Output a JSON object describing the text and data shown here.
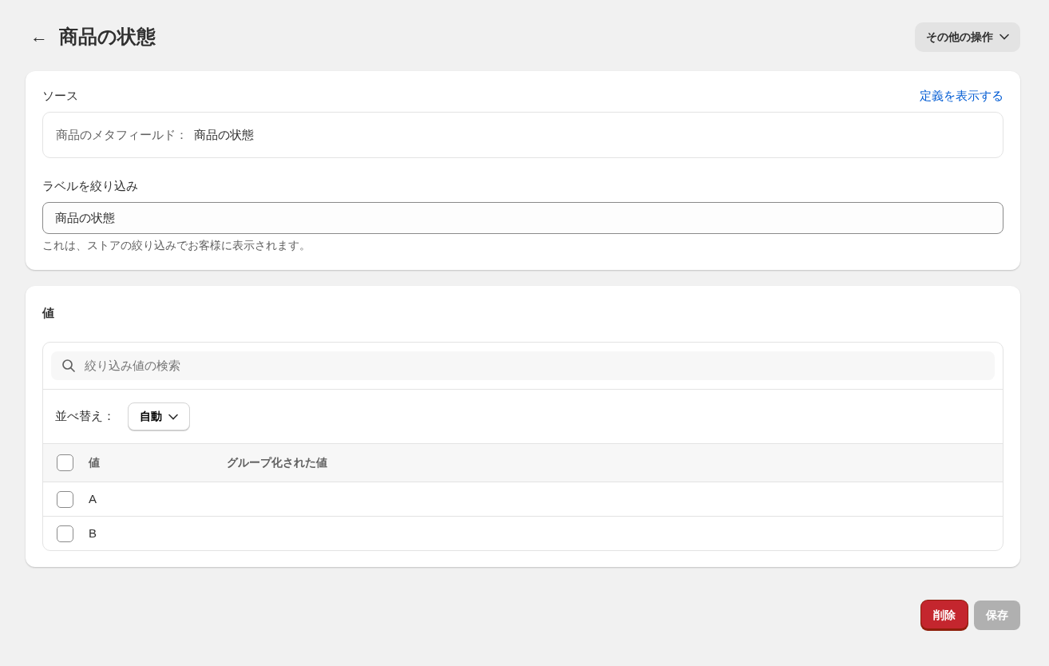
{
  "header": {
    "back": "←",
    "title": "商品の状態",
    "more_actions": "その他の操作"
  },
  "source_card": {
    "label": "ソース",
    "link": "定義を表示する",
    "source_prefix": "商品のメタフィールド：",
    "source_value": "商品の状態",
    "filter_label": "ラベルを絞り込み",
    "filter_value": "商品の状態",
    "help": "これは、ストアの絞り込みでお客様に表示されます。"
  },
  "values_card": {
    "title": "値",
    "search": {
      "placeholder": "絞り込み値の検索"
    },
    "sort_label": "並べ替え：",
    "sort_value": "自動",
    "table": {
      "select_all_checked": false,
      "columns": [
        "値",
        "グループ化された値"
      ],
      "rows": [
        {
          "value": "A",
          "checked": false
        },
        {
          "value": "B",
          "checked": false
        }
      ]
    }
  },
  "footer": {
    "buttons": [
      {
        "label": "削除",
        "kind": "danger",
        "disabled": false
      },
      {
        "label": "保存",
        "kind": "primary",
        "disabled": true
      }
    ]
  }
}
